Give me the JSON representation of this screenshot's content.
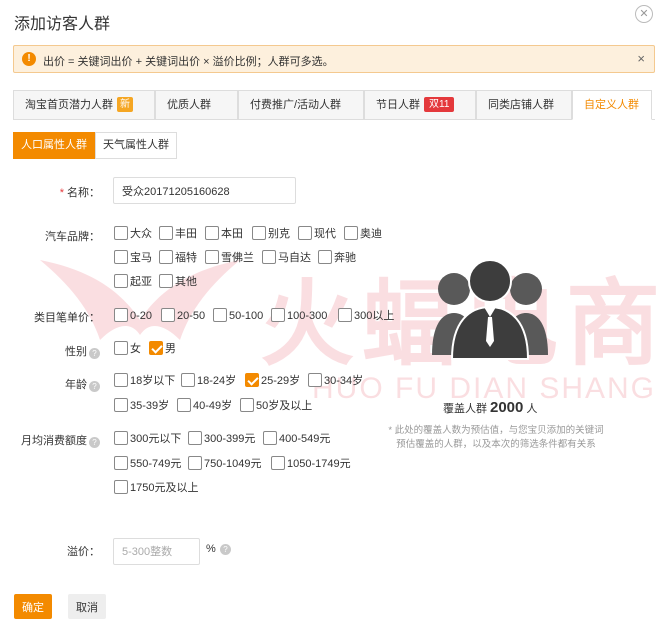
{
  "dialog": {
    "title": "添加访客人群",
    "close_icon": "close-icon"
  },
  "alert": {
    "text": "出价 = 关键词出价 + 关键词出价 × 溢价比例；人群可多选。",
    "close": "×"
  },
  "tabs": [
    {
      "label": "淘宝首页潜力人群",
      "badge": "新",
      "active": false
    },
    {
      "label": "优质人群",
      "active": false
    },
    {
      "label": "付费推广/活动人群",
      "active": false
    },
    {
      "label": "节日人群",
      "badge": "双11",
      "active": false
    },
    {
      "label": "同类店铺人群",
      "active": false
    },
    {
      "label": "自定义人群",
      "active": true
    }
  ],
  "subtabs": [
    {
      "label": "人口属性人群",
      "active": true
    },
    {
      "label": "天气属性人群",
      "active": false
    }
  ],
  "form": {
    "name_label": "名称：",
    "name_value": "受众20171205160628",
    "car_label": "汽车品牌：",
    "price_label": "类目笔单价：",
    "gender_label": "性别",
    "age_label": "年龄",
    "spend_label": "月均消费额度",
    "bid_label": "溢价：",
    "bid_placeholder": "5-300整数",
    "bid_unit": "%"
  },
  "car_brands": [
    {
      "label": "大众",
      "checked": false
    },
    {
      "label": "丰田",
      "checked": false
    },
    {
      "label": "本田",
      "checked": false
    },
    {
      "label": "别克",
      "checked": false
    },
    {
      "label": "现代",
      "checked": false
    },
    {
      "label": "奥迪",
      "checked": false
    },
    {
      "label": "宝马",
      "checked": false
    },
    {
      "label": "福特",
      "checked": false
    },
    {
      "label": "雪佛兰",
      "checked": false
    },
    {
      "label": "马自达",
      "checked": false
    },
    {
      "label": "奔驰",
      "checked": false
    },
    {
      "label": "起亚",
      "checked": false
    },
    {
      "label": "其他",
      "checked": false
    }
  ],
  "price_ranges": [
    {
      "label": "0-20",
      "checked": false
    },
    {
      "label": "20-50",
      "checked": false
    },
    {
      "label": "50-100",
      "checked": false
    },
    {
      "label": "100-300",
      "checked": false
    },
    {
      "label": "300以上",
      "checked": false
    }
  ],
  "genders": [
    {
      "label": "女",
      "checked": false
    },
    {
      "label": "男",
      "checked": true
    }
  ],
  "ages": [
    {
      "label": "18岁以下",
      "checked": false
    },
    {
      "label": "18-24岁",
      "checked": false
    },
    {
      "label": "25-29岁",
      "checked": true
    },
    {
      "label": "30-34岁",
      "checked": false
    },
    {
      "label": "35-39岁",
      "checked": false
    },
    {
      "label": "40-49岁",
      "checked": false
    },
    {
      "label": "50岁及以上",
      "checked": false
    }
  ],
  "spending": [
    {
      "label": "300元以下",
      "checked": false
    },
    {
      "label": "300-399元",
      "checked": false
    },
    {
      "label": "400-549元",
      "checked": false
    },
    {
      "label": "550-749元",
      "checked": false
    },
    {
      "label": "750-1049元",
      "checked": false
    },
    {
      "label": "1050-1749元",
      "checked": false
    },
    {
      "label": "1750元及以上",
      "checked": false
    }
  ],
  "coverage": {
    "prefix": "覆盖人群",
    "count": "2000",
    "suffix": "人",
    "note": "* 此处的覆盖人数为预估值，与您宝贝添加的关键词预估覆盖的人群，以及本次的筛选条件都有关系"
  },
  "watermark": {
    "main": "火蝠电商",
    "sub": "HUO FU DIAN SHANG"
  },
  "buttons": {
    "ok": "确定",
    "cancel": "取消"
  },
  "colors": {
    "accent": "#f38a00",
    "alert_bg": "#fdf0dd",
    "badge_red": "#e4393c"
  }
}
